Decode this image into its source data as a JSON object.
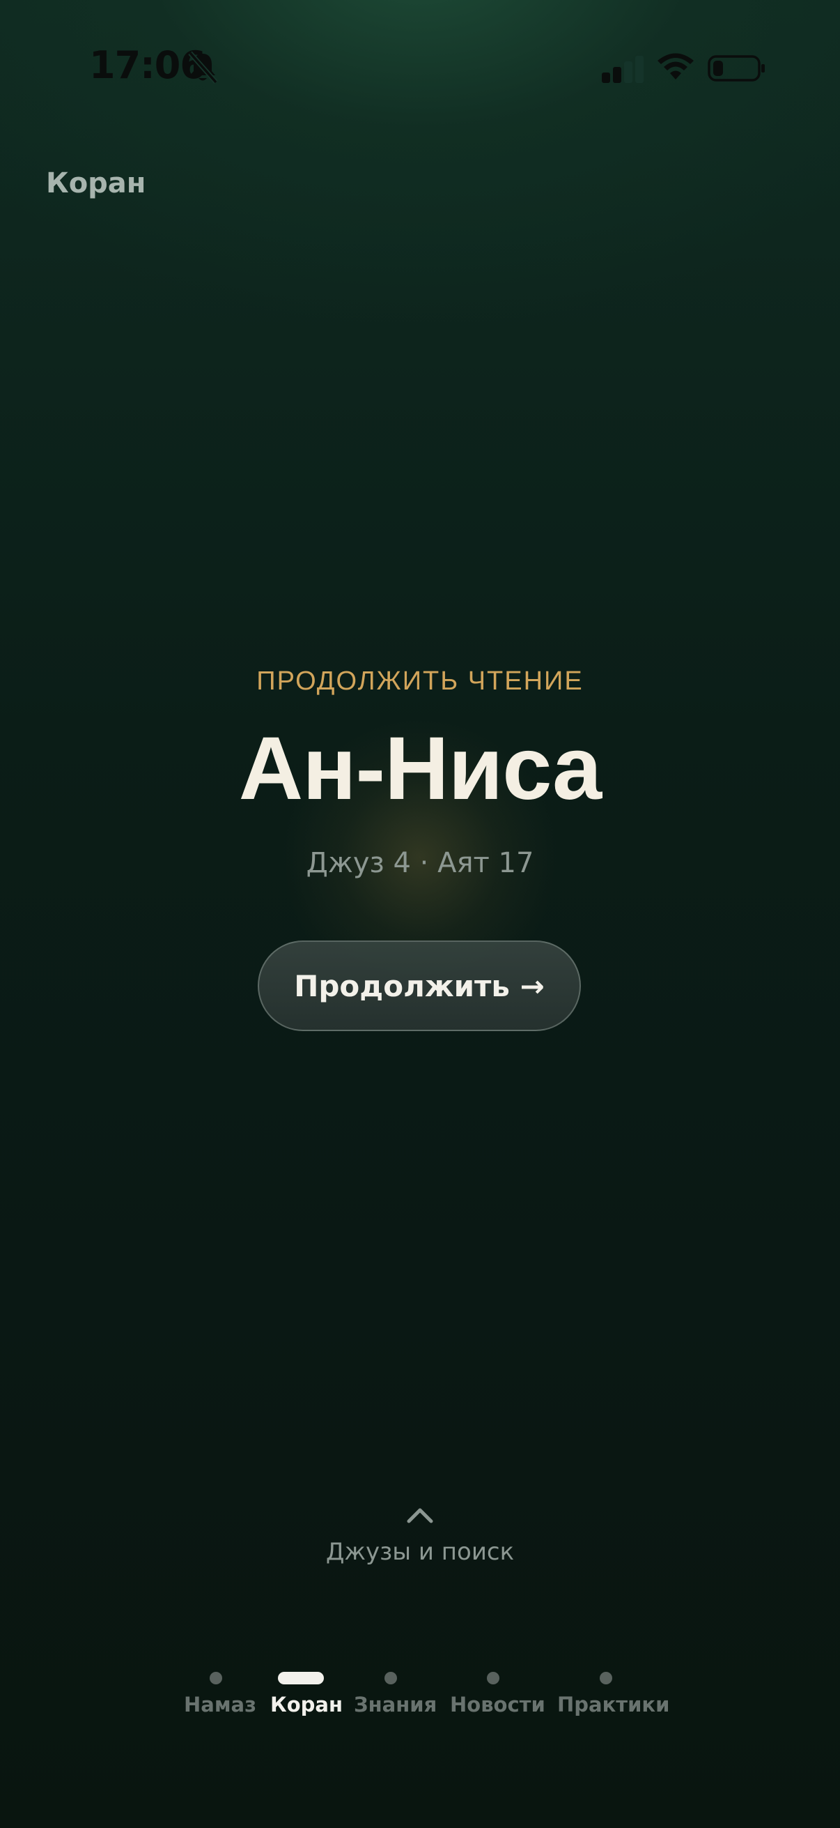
{
  "status_bar": {
    "time": "17:06"
  },
  "header": {
    "title": "Коран"
  },
  "continue_reading": {
    "label": "ПРОДОЛЖИТЬ ЧТЕНИЕ",
    "surah_name": "Ан-Ниса",
    "meta": "Джуз 4 · Аят 17",
    "button_label": "Продолжить →"
  },
  "juz_search": {
    "label": "Джузы и поиск"
  },
  "tabs": [
    {
      "label": "Намаз",
      "active": false
    },
    {
      "label": "Коран",
      "active": true
    },
    {
      "label": "Знания",
      "active": false
    },
    {
      "label": "Новости",
      "active": false
    },
    {
      "label": "Практики",
      "active": false
    }
  ],
  "colors": {
    "accent_gold": "#d2a55b",
    "title_text": "#f4efe3",
    "muted_text": "#8d9892",
    "background": "#0b1d17"
  }
}
